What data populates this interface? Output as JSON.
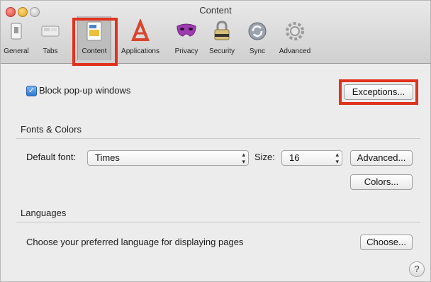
{
  "window": {
    "title": "Content"
  },
  "toolbar": {
    "items": [
      {
        "label": "General",
        "icon": "general-switch-icon"
      },
      {
        "label": "Tabs",
        "icon": "tabs-icon"
      },
      {
        "label": "Content",
        "icon": "content-icon",
        "selected": true
      },
      {
        "label": "Applications",
        "icon": "applications-icon"
      },
      {
        "label": "Privacy",
        "icon": "privacy-mask-icon"
      },
      {
        "label": "Security",
        "icon": "security-lock-icon"
      },
      {
        "label": "Sync",
        "icon": "sync-icon"
      },
      {
        "label": "Advanced",
        "icon": "advanced-gear-icon"
      }
    ]
  },
  "popups": {
    "checkbox_checked": true,
    "block_label": "Block pop-up windows",
    "exceptions_label": "Exceptions..."
  },
  "fonts": {
    "section_title": "Fonts & Colors",
    "default_font_label": "Default font:",
    "default_font_value": "Times",
    "size_label": "Size:",
    "size_value": "16",
    "advanced_label": "Advanced...",
    "colors_label": "Colors..."
  },
  "languages": {
    "section_title": "Languages",
    "description": "Choose your preferred language for displaying pages",
    "choose_label": "Choose..."
  },
  "help": {
    "label": "?"
  },
  "colors": {
    "highlight": "#e0321c",
    "checkbox": "#2a77d6"
  }
}
